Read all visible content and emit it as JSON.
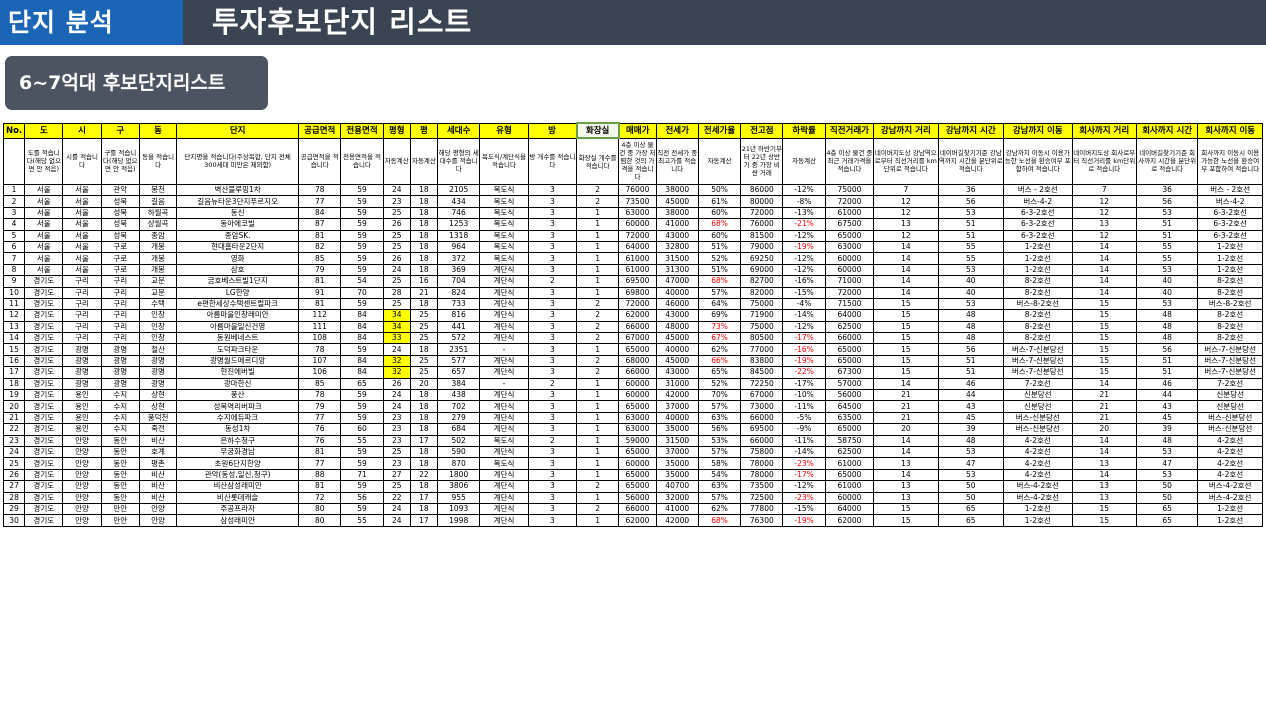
{
  "header": {
    "section": "단지 분석",
    "title": "투자후보단지 리스트"
  },
  "subtitle": "6~7억대 후보단지리스트",
  "table": {
    "columns": [
      "No.",
      "도",
      "시",
      "구",
      "동",
      "단지",
      "공급면적",
      "전용면적",
      "평형",
      "평",
      "세대수",
      "유형",
      "방",
      "화장실",
      "매매가",
      "전세가",
      "전세가율",
      "전고점",
      "하락률",
      "직전거래가",
      "강남까지 거리",
      "강남까지 시간",
      "강남까지 이동",
      "회사까지 거리",
      "회사까지 시간",
      "회사까지 이동"
    ],
    "descriptions": [
      "",
      "도를 적습니다(해당 없으면 안 적음)",
      "시를 적습니다",
      "구를 적습니다(해당 없으면 안 적음)",
      "동을 적습니다",
      "단지명을 적습니다(주상복합, 단지 전체 300세대 미만은 제외함)",
      "공급면적을 적습니다",
      "전용면적을 적습니다",
      "자동계산",
      "자동계산",
      "해당 평형의 세대수를 적습니다",
      "복도식/계단식을 적습니다",
      "방 개수를 적습니다",
      "화장실 개수를 적습니다",
      "4층 이상 물건 중 가장 저렴한 것의 가격을 적습니다",
      "직전 전세가 중 최고가를 적습니다",
      "자동계산",
      "21년 하반기부터 22년 상반기 중 가장 비싼 거래",
      "자동계산",
      "4층 이상 물건 중 최근 거래가격을 적습니다",
      "네이버지도상 강남역으로부터 직선거리를 km단위로 적습니다",
      "네이버길찾기기준 강남역까지 시간을 분단위로 적습니다",
      "강남까지 이동시 이용가능한 노선을 환승여부 포함하여 적습니다",
      "네이버지도상 회사로부터 직선거리를 km단위로 적습니다",
      "네이버길찾기기준 회사까지 시간을 분단위로 적습니다",
      "회사까지 이동시 이용가능한 노선을 환승여부 포함하여 적습니다"
    ],
    "rows": [
      [
        "1",
        "서울",
        "서울",
        "관악",
        "봉천",
        "벽산블루밍1차",
        "78",
        "59",
        "24",
        "18",
        "2105",
        "복도식",
        "3",
        "2",
        "76000",
        "38000",
        "50%",
        "86000",
        "-12%",
        "75000",
        "7",
        "36",
        "버스 - 2호선",
        "7",
        "36",
        "버스 - 2호선"
      ],
      [
        "2",
        "서울",
        "서울",
        "성북",
        "길음",
        "길음뉴타운3단지푸르지오",
        "77",
        "59",
        "23",
        "18",
        "434",
        "복도식",
        "3",
        "2",
        "73500",
        "45000",
        "61%",
        "80000",
        "-8%",
        "72000",
        "12",
        "56",
        "버스-4-2",
        "12",
        "56",
        "버스-4-2"
      ],
      [
        "3",
        "서울",
        "서울",
        "성북",
        "하월곡",
        "동신",
        "84",
        "59",
        "25",
        "18",
        "746",
        "복도식",
        "3",
        "1",
        "63000",
        "38000",
        "60%",
        "72000",
        "-13%",
        "61000",
        "12",
        "53",
        "6-3-2호선",
        "12",
        "53",
        "6-3-2호선"
      ],
      [
        "4",
        "서울",
        "서울",
        "성북",
        "상월곡",
        "동아에코빌",
        "87",
        "59",
        "26",
        "18",
        "1253",
        "복도식",
        "3",
        "1",
        "60000",
        "41000",
        "68%",
        "76000",
        "-21%",
        "67500",
        "13",
        "51",
        "6-3-2호선",
        "13",
        "51",
        "6-3-2호선"
      ],
      [
        "5",
        "서울",
        "서울",
        "성북",
        "종암",
        "종암SK.",
        "81",
        "59",
        "25",
        "18",
        "1318",
        "복도식",
        "3",
        "1",
        "72000",
        "43000",
        "60%",
        "81500",
        "-12%",
        "65000",
        "12",
        "51",
        "6-3-2호선",
        "12",
        "51",
        "6-3-2호선"
      ],
      [
        "6",
        "서울",
        "서울",
        "구로",
        "개봉",
        "현대홈타운2단지",
        "82",
        "59",
        "25",
        "18",
        "964",
        "복도식",
        "3",
        "1",
        "64000",
        "32800",
        "51%",
        "79000",
        "-19%",
        "63000",
        "14",
        "55",
        "1-2호선",
        "14",
        "55",
        "1-2호선"
      ],
      [
        "7",
        "서울",
        "서울",
        "구로",
        "개봉",
        "영화",
        "85",
        "59",
        "26",
        "18",
        "372",
        "복도식",
        "3",
        "1",
        "61000",
        "31500",
        "52%",
        "69250",
        "-12%",
        "60000",
        "14",
        "55",
        "1-2호선",
        "14",
        "55",
        "1-2호선"
      ],
      [
        "8",
        "서울",
        "서울",
        "구로",
        "개봉",
        "삼호",
        "79",
        "59",
        "24",
        "18",
        "369",
        "계단식",
        "3",
        "1",
        "61000",
        "31300",
        "51%",
        "69000",
        "-12%",
        "60000",
        "14",
        "53",
        "1-2호선",
        "14",
        "53",
        "1-2호선"
      ],
      [
        "9",
        "경기도",
        "구리",
        "구리",
        "교문",
        "금호베스트빌1단지",
        "81",
        "54",
        "25",
        "16",
        "704",
        "계단식",
        "2",
        "1",
        "69500",
        "47000",
        "68%",
        "82700",
        "-16%",
        "71000",
        "14",
        "40",
        "8-2호선",
        "14",
        "40",
        "8-2호선"
      ],
      [
        "10",
        "경기도",
        "구리",
        "구리",
        "교문",
        "LG한양",
        "91",
        "70",
        "28",
        "21",
        "824",
        "계단식",
        "3",
        "1",
        "69800",
        "40000",
        "57%",
        "82000",
        "-15%",
        "72000",
        "14",
        "40",
        "8-2호선",
        "14",
        "40",
        "8-2호선"
      ],
      [
        "11",
        "경기도",
        "구리",
        "구리",
        "수택",
        "e편한세상수택센트럴파크",
        "81",
        "59",
        "25",
        "18",
        "733",
        "계단식",
        "3",
        "2",
        "72000",
        "46000",
        "64%",
        "75000",
        "-4%",
        "71500",
        "15",
        "53",
        "버스-8-2호선",
        "15",
        "53",
        "버스-8-2호선"
      ],
      [
        "12",
        "경기도",
        "구리",
        "구리",
        "인창",
        "아름마을인창래미안",
        "112",
        "84",
        "34",
        "25",
        "816",
        "계단식",
        "3",
        "2",
        "62000",
        "43000",
        "69%",
        "71900",
        "-14%",
        "64000",
        "15",
        "48",
        "8-2호선",
        "15",
        "48",
        "8-2호선"
      ],
      [
        "13",
        "경기도",
        "구리",
        "구리",
        "인창",
        "아름마을일신건영",
        "111",
        "84",
        "34",
        "25",
        "441",
        "계단식",
        "3",
        "2",
        "66000",
        "48000",
        "73%",
        "75000",
        "-12%",
        "62500",
        "15",
        "48",
        "8-2호선",
        "15",
        "48",
        "8-2호선"
      ],
      [
        "14",
        "경기도",
        "구리",
        "구리",
        "인창",
        "동원베네스트",
        "108",
        "84",
        "33",
        "25",
        "572",
        "계단식",
        "3",
        "2",
        "67000",
        "45000",
        "67%",
        "80500",
        "-17%",
        "66000",
        "15",
        "48",
        "8-2호선",
        "15",
        "48",
        "8-2호선"
      ],
      [
        "15",
        "경기도",
        "광명",
        "광명",
        "철산",
        "도덕파크타운",
        "78",
        "59",
        "24",
        "18",
        "2351",
        "-",
        "3",
        "1",
        "65000",
        "40000",
        "62%",
        "77000",
        "-16%",
        "65000",
        "15",
        "56",
        "버스-7-신분당선",
        "15",
        "56",
        "버스-7-신분당선"
      ],
      [
        "16",
        "경기도",
        "광명",
        "광명",
        "광명",
        "광명월드메르디앙",
        "107",
        "84",
        "32",
        "25",
        "577",
        "계단식",
        "3",
        "2",
        "68000",
        "45000",
        "66%",
        "83800",
        "-19%",
        "65000",
        "15",
        "51",
        "버스-7-신분당선",
        "15",
        "51",
        "버스-7-신분당선"
      ],
      [
        "17",
        "경기도",
        "광명",
        "광명",
        "광명",
        "현진에버빌",
        "106",
        "84",
        "32",
        "25",
        "657",
        "계단식",
        "3",
        "2",
        "66000",
        "43000",
        "65%",
        "84500",
        "-22%",
        "67300",
        "15",
        "51",
        "버스-7-신분당선",
        "15",
        "51",
        "버스-7-신분당선"
      ],
      [
        "18",
        "경기도",
        "광명",
        "광명",
        "광명",
        "광마한신",
        "85",
        "65",
        "26",
        "20",
        "384",
        "-",
        "2",
        "1",
        "60000",
        "31000",
        "52%",
        "72250",
        "-17%",
        "57000",
        "14",
        "46",
        "7-2호선",
        "14",
        "46",
        "7-2호선"
      ],
      [
        "19",
        "경기도",
        "용인",
        "수지",
        "상현",
        "풍산",
        "78",
        "59",
        "24",
        "18",
        "438",
        "계단식",
        "3",
        "1",
        "60000",
        "42000",
        "70%",
        "67000",
        "-10%",
        "56000",
        "21",
        "44",
        "신분당선",
        "21",
        "44",
        "신분당선"
      ],
      [
        "20",
        "경기도",
        "용인",
        "수지",
        "상현",
        "성복역리버파크",
        "79",
        "59",
        "24",
        "18",
        "702",
        "계단식",
        "3",
        "1",
        "65000",
        "37000",
        "57%",
        "73000",
        "-11%",
        "64500",
        "21",
        "43",
        "신분당선",
        "21",
        "43",
        "신분당선"
      ],
      [
        "21",
        "경기도",
        "용인",
        "수지",
        "풍덕천",
        "수지에듀파크",
        "77",
        "59",
        "23",
        "18",
        "279",
        "계단식",
        "3",
        "1",
        "63000",
        "40000",
        "63%",
        "66000",
        "-5%",
        "63500",
        "21",
        "45",
        "버스-신분당선",
        "21",
        "45",
        "버스-신분당선"
      ],
      [
        "22",
        "경기도",
        "용인",
        "수지",
        "죽전",
        "동성1차",
        "76",
        "60",
        "23",
        "18",
        "684",
        "계단식",
        "3",
        "1",
        "63000",
        "35000",
        "56%",
        "69500",
        "-9%",
        "65000",
        "20",
        "39",
        "버스-신분당선",
        "20",
        "39",
        "버스-신분당선"
      ],
      [
        "23",
        "경기도",
        "안양",
        "동안",
        "비산",
        "은하수청구",
        "76",
        "55",
        "23",
        "17",
        "502",
        "복도식",
        "2",
        "1",
        "59000",
        "31500",
        "53%",
        "66000",
        "-11%",
        "58750",
        "14",
        "48",
        "4-2호선",
        "14",
        "48",
        "4-2호선"
      ],
      [
        "24",
        "경기도",
        "안양",
        "동안",
        "호계",
        "무궁화경남",
        "81",
        "59",
        "25",
        "18",
        "590",
        "계단식",
        "3",
        "1",
        "65000",
        "37000",
        "57%",
        "75800",
        "-14%",
        "62500",
        "14",
        "53",
        "4-2호선",
        "14",
        "53",
        "4-2호선"
      ],
      [
        "25",
        "경기도",
        "안양",
        "동안",
        "평촌",
        "초원6단지한양",
        "77",
        "59",
        "23",
        "18",
        "870",
        "복도식",
        "3",
        "1",
        "60000",
        "35000",
        "58%",
        "78000",
        "-23%",
        "61000",
        "13",
        "47",
        "4-2호선",
        "13",
        "47",
        "4-2호선"
      ],
      [
        "26",
        "경기도",
        "안양",
        "동안",
        "비산",
        "관악(동성,일신,청구)",
        "88",
        "71",
        "27",
        "22",
        "1800",
        "계단식",
        "3",
        "1",
        "65000",
        "35000",
        "54%",
        "78000",
        "-17%",
        "65000",
        "14",
        "53",
        "4-2호선",
        "14",
        "53",
        "4-2호선"
      ],
      [
        "27",
        "경기도",
        "안양",
        "동안",
        "비산",
        "비산삼성래미안",
        "81",
        "59",
        "25",
        "18",
        "3806",
        "계단식",
        "3",
        "2",
        "65000",
        "40700",
        "63%",
        "73500",
        "-12%",
        "61000",
        "13",
        "50",
        "버스-4-2호선",
        "13",
        "50",
        "버스-4-2호선"
      ],
      [
        "28",
        "경기도",
        "안양",
        "동안",
        "비산",
        "비산롯데캐슬",
        "72",
        "56",
        "22",
        "17",
        "955",
        "계단식",
        "3",
        "1",
        "56000",
        "32000",
        "57%",
        "72500",
        "-23%",
        "60000",
        "13",
        "50",
        "버스-4-2호선",
        "13",
        "50",
        "버스-4-2호선"
      ],
      [
        "29",
        "경기도",
        "안양",
        "만안",
        "안양",
        "주공프라자",
        "80",
        "59",
        "24",
        "18",
        "1093",
        "계단식",
        "3",
        "2",
        "66000",
        "41000",
        "62%",
        "77800",
        "-15%",
        "64000",
        "15",
        "65",
        "1-2호선",
        "15",
        "65",
        "1-2호선"
      ],
      [
        "30",
        "경기도",
        "안양",
        "만안",
        "안양",
        "삼성래미안",
        "80",
        "55",
        "24",
        "17",
        "1998",
        "계단식",
        "3",
        "1",
        "62000",
        "42000",
        "68%",
        "76300",
        "-19%",
        "62000",
        "15",
        "65",
        "1-2호선",
        "15",
        "65",
        "1-2호선"
      ]
    ],
    "red_cells": [
      [
        3,
        16
      ],
      [
        3,
        18
      ],
      [
        5,
        18
      ],
      [
        8,
        16
      ],
      [
        12,
        16
      ],
      [
        13,
        16
      ],
      [
        13,
        18
      ],
      [
        14,
        18
      ],
      [
        15,
        16
      ],
      [
        15,
        18
      ],
      [
        16,
        18
      ],
      [
        24,
        18
      ],
      [
        25,
        18
      ],
      [
        27,
        18
      ],
      [
        29,
        16
      ],
      [
        29,
        18
      ]
    ],
    "yellow_cells": [
      [
        11,
        8
      ],
      [
        12,
        8
      ],
      [
        13,
        8
      ],
      [
        15,
        8
      ],
      [
        16,
        8
      ]
    ]
  }
}
